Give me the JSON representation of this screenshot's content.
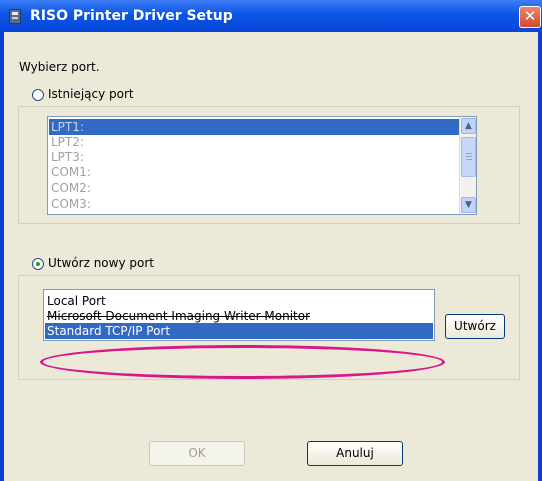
{
  "window": {
    "title": "RISO Printer Driver Setup",
    "close_symbol": "✕"
  },
  "prompt": "Wybierz port.",
  "existing_port": {
    "label": "Istniejący port",
    "selected": false,
    "items": [
      "LPT1:",
      "LPT2:",
      "LPT3:",
      "COM1:",
      "COM2:",
      "COM3:"
    ],
    "selected_item": "LPT1:"
  },
  "new_port": {
    "label": "Utwórz nowy port",
    "selected": true,
    "items": [
      "Local Port",
      "Microsoft Document Imaging Writer Monitor",
      "Standard TCP/IP Port"
    ],
    "selected_item": "Standard TCP/IP Port",
    "create_button": "Utwórz"
  },
  "buttons": {
    "ok": "OK",
    "cancel": "Anuluj"
  },
  "colors": {
    "highlight": "#316ac5",
    "annotation": "#d9168c",
    "title_bar": "#0a55e6"
  }
}
